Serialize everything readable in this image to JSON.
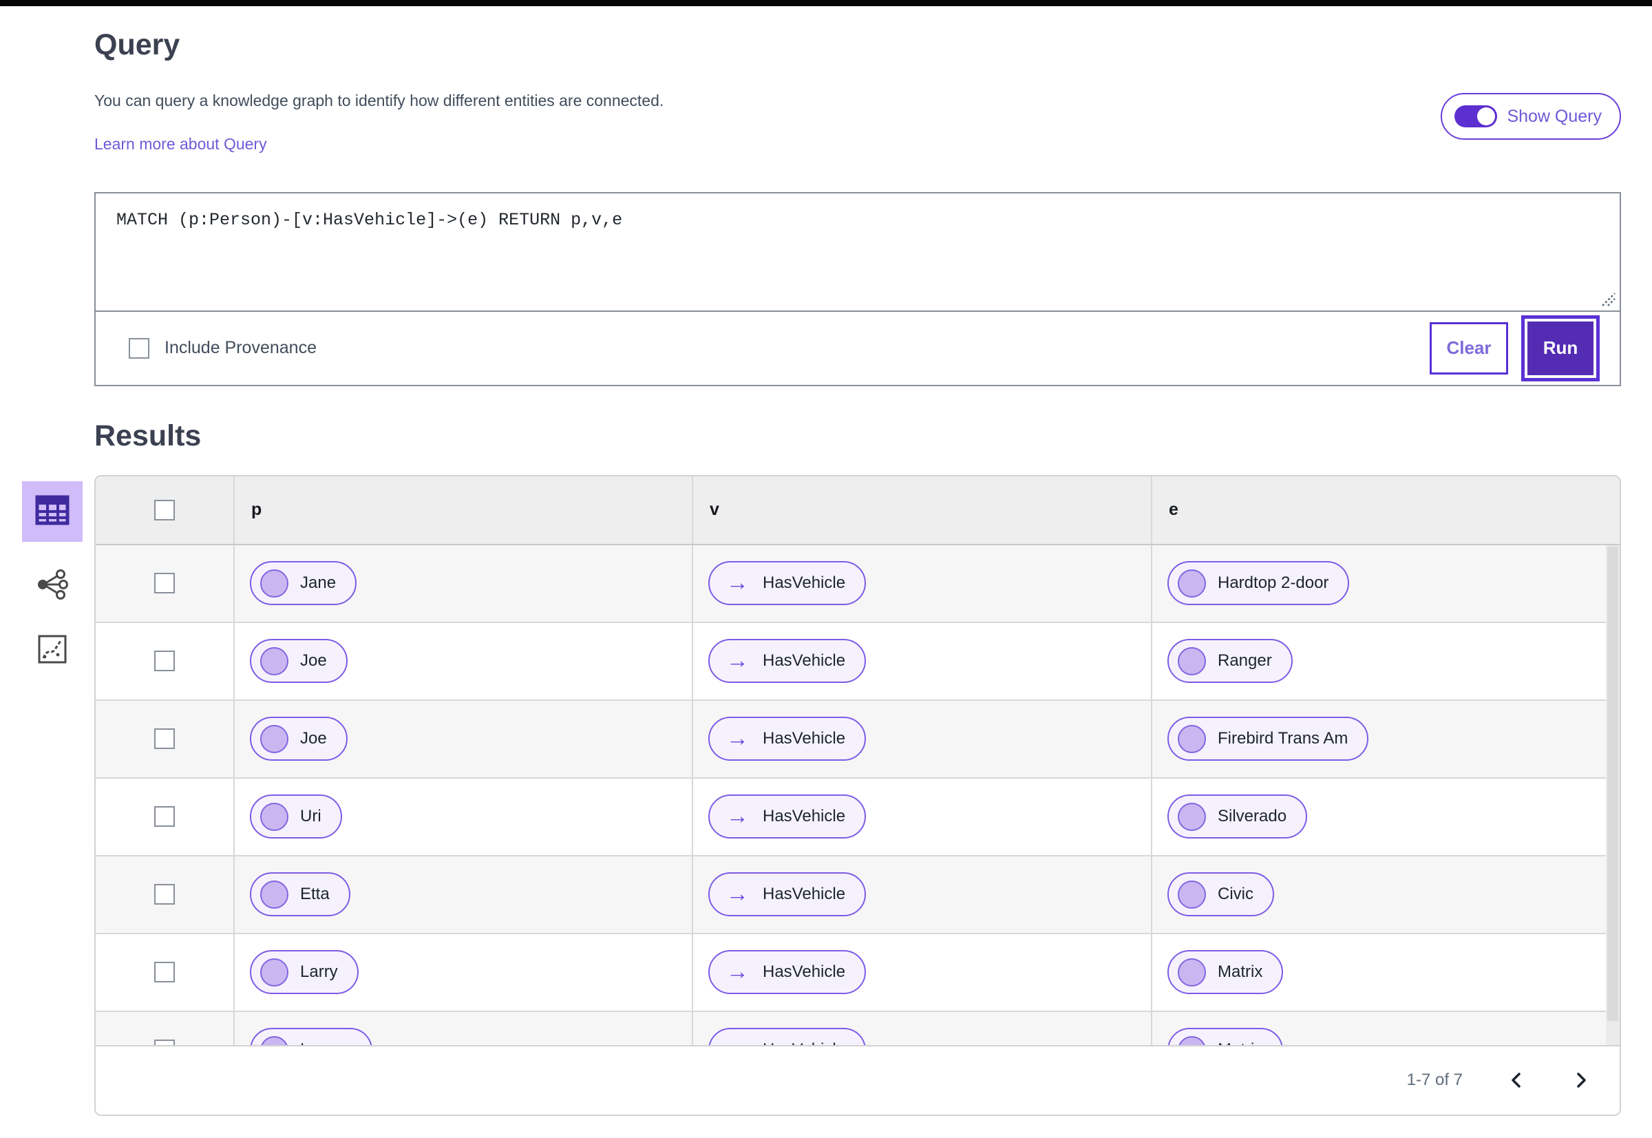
{
  "colors": {
    "primary_purple": "#5a31d6",
    "run_button_fill": "#542cb4",
    "pill_border": "#7d5ce6",
    "pill_background": "#f5f2fd",
    "node_fill": "#cab7f1",
    "link": "#6d5bd7",
    "selected_view_tile_bg": "#cfbcf9",
    "view_tile_icon": "#3f2b9e",
    "table_header_bg": "#eeeeee",
    "alt_row_bg": "#f6f6f6"
  },
  "icons": {
    "edge_arrow": "→"
  },
  "query_section": {
    "title": "Query",
    "description": "You can query a knowledge graph to identify how different entities are connected.",
    "learn_more_label": "Learn more about Query",
    "show_query_toggle": {
      "label": "Show Query",
      "state": "on"
    },
    "editor": {
      "query_text": "MATCH (p:Person)-[v:HasVehicle]->(e) RETURN p,v,e"
    },
    "include_provenance": {
      "label": "Include Provenance",
      "checked": false
    },
    "buttons": {
      "clear": "Clear",
      "run": "Run"
    }
  },
  "results_section": {
    "title": "Results",
    "view_switcher": [
      {
        "name": "table-view",
        "selected": true
      },
      {
        "name": "graph-view",
        "selected": false
      },
      {
        "name": "chart-view",
        "selected": false
      }
    ],
    "table": {
      "columns": [
        "p",
        "v",
        "e"
      ],
      "rows": [
        {
          "p": "Jane",
          "v": "HasVehicle",
          "e": "Hardtop 2-door"
        },
        {
          "p": "Joe",
          "v": "HasVehicle",
          "e": "Ranger"
        },
        {
          "p": "Joe",
          "v": "HasVehicle",
          "e": "Firebird Trans Am"
        },
        {
          "p": "Uri",
          "v": "HasVehicle",
          "e": "Silverado"
        },
        {
          "p": "Etta",
          "v": "HasVehicle",
          "e": "Civic"
        },
        {
          "p": "Larry",
          "v": "HasVehicle",
          "e": "Matrix"
        },
        {
          "p": "Lauren",
          "v": "HasVehicle",
          "e": "Matrix"
        }
      ]
    },
    "pagination": {
      "range_label": "1-7 of 7"
    }
  }
}
